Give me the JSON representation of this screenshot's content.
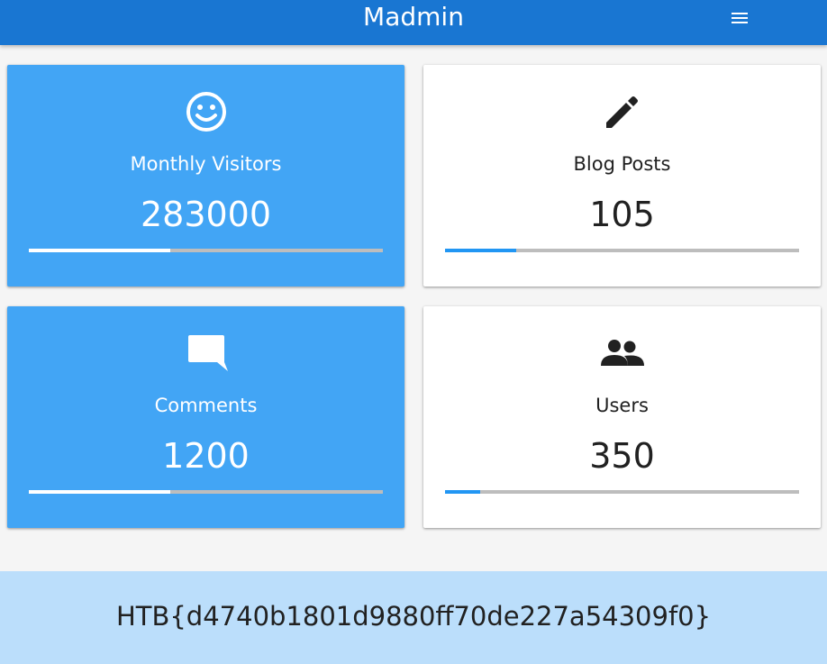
{
  "app": {
    "title": "Madmin",
    "menu_icon": "menu-icon"
  },
  "colors": {
    "appbar": "#1976d2",
    "card_blue": "#42a5f5",
    "card_white": "#ffffff",
    "progress_accent": "#2196f3",
    "banner": "#bbdefb"
  },
  "cards": [
    {
      "label": "Monthly Visitors",
      "value": "283000",
      "icon": "smiley-face-icon",
      "progress": 0.4
    },
    {
      "label": "Blog Posts",
      "value": "105",
      "icon": "pencil-icon",
      "progress": 0.2
    },
    {
      "label": "Comments",
      "value": "1200",
      "icon": "comment-bubble-icon",
      "progress": 0.4
    },
    {
      "label": "Users",
      "value": "350",
      "icon": "people-icon",
      "progress": 0.1
    }
  ],
  "banner": {
    "text": "HTB{d4740b1801d9880ff70de227a54309f0}"
  }
}
